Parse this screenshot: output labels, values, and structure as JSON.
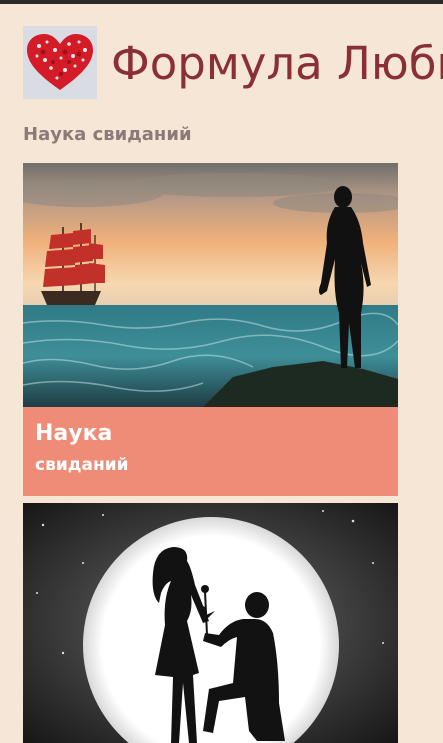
{
  "header": {
    "title": "Формула Любви",
    "logo_icon": "heart-collage-icon"
  },
  "section": {
    "title": "Наука свиданий"
  },
  "cards": [
    {
      "image_icon": "sailing-ship-silhouette-image",
      "caption_main": "Наука",
      "caption_sub": "свиданий"
    },
    {
      "image_icon": "moon-proposal-silhouette-image"
    }
  ],
  "colors": {
    "background": "#f5e6d6",
    "title": "#8a2f34",
    "section_title": "#8c7a7a",
    "caption_bg": "#ef8c78"
  }
}
